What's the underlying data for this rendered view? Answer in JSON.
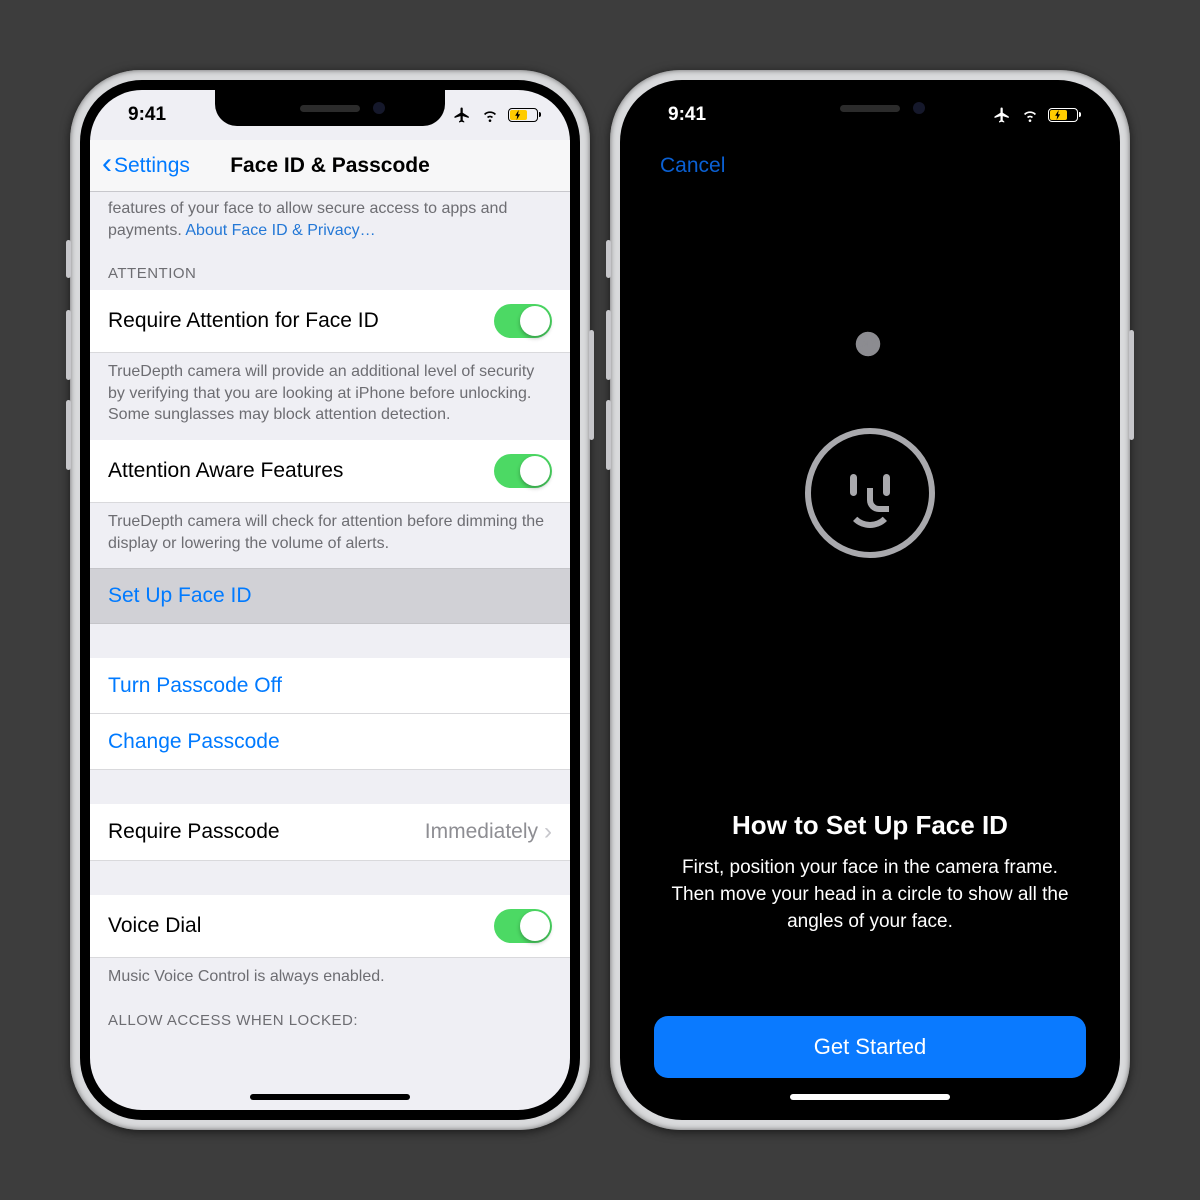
{
  "left": {
    "status_time": "9:41",
    "back_label": "Settings",
    "title": "Face ID & Passcode",
    "intro_text": "features of your face to allow secure access to apps and payments. ",
    "intro_link": "About Face ID & Privacy…",
    "attention_header": "ATTENTION",
    "row_require_attention": "Require Attention for Face ID",
    "desc_require_attention": "TrueDepth camera will provide an additional level of security by verifying that you are looking at iPhone before unlocking. Some sunglasses may block attention detection.",
    "row_attention_aware": "Attention Aware Features",
    "desc_attention_aware": "TrueDepth camera will check for attention before dimming the display or lowering the volume of alerts.",
    "row_setup_faceid": "Set Up Face ID",
    "row_turn_passcode_off": "Turn Passcode Off",
    "row_change_passcode": "Change Passcode",
    "row_require_passcode": "Require Passcode",
    "row_require_passcode_value": "Immediately",
    "row_voice_dial": "Voice Dial",
    "desc_voice_dial": "Music Voice Control is always enabled.",
    "allow_access_header": "ALLOW ACCESS WHEN LOCKED:"
  },
  "right": {
    "status_time": "9:41",
    "cancel": "Cancel",
    "heading": "How to Set Up Face ID",
    "body": "First, position your face in the camera frame. Then move your head in a circle to show all the angles of your face.",
    "button": "Get Started"
  }
}
